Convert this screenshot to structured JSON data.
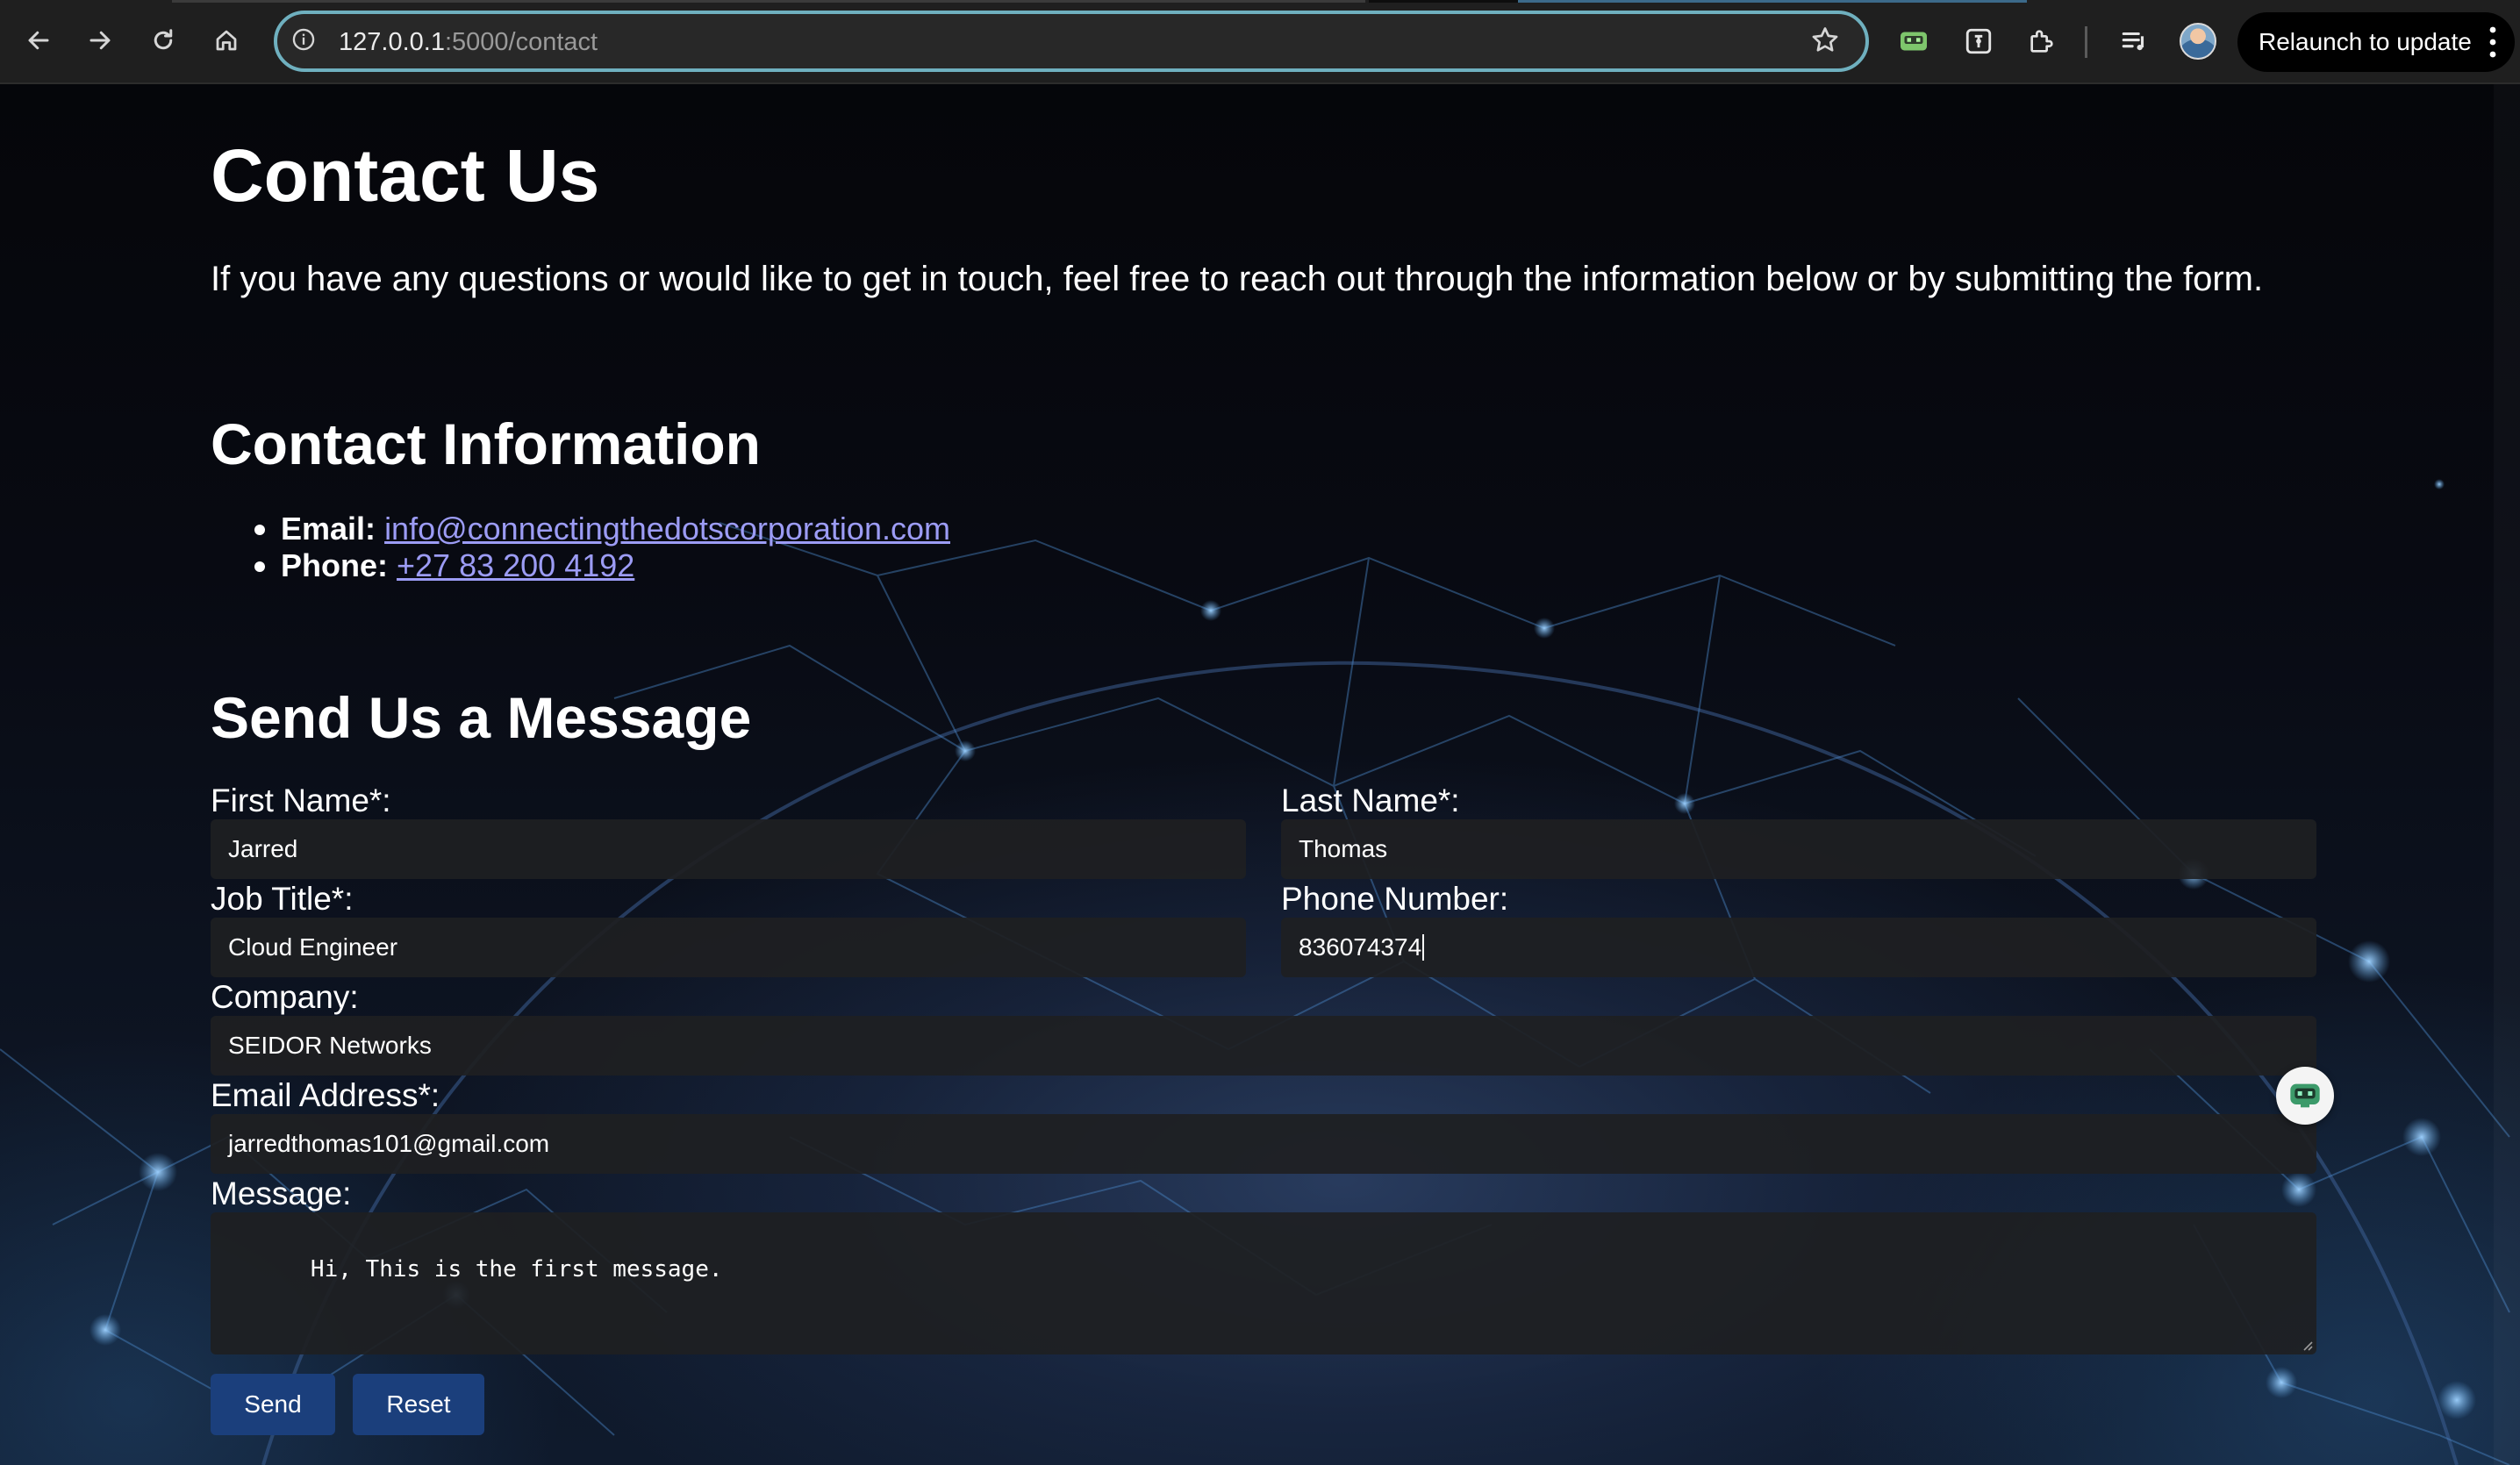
{
  "browser": {
    "url_host": "127.0.0.1",
    "url_path": ":5000/contact",
    "relaunch_label": "Relaunch to update"
  },
  "page": {
    "title": "Contact Us",
    "intro": "If you have any questions or would like to get in touch, feel free to reach out through the information below or by submitting the form.",
    "contact_info": {
      "heading": "Contact Information",
      "email_label": "Email:",
      "email_value": "info@connectingthedotscorporation.com",
      "phone_label": "Phone:",
      "phone_value": "+27 83 200 4192"
    },
    "form": {
      "heading": "Send Us a Message",
      "first_name": {
        "label": "First Name*:",
        "value": "Jarred"
      },
      "last_name": {
        "label": "Last Name*:",
        "value": "Thomas"
      },
      "job_title": {
        "label": "Job Title*:",
        "value": "Cloud Engineer"
      },
      "phone_number": {
        "label": "Phone Number:",
        "value": "836074374"
      },
      "company": {
        "label": "Company:",
        "value": "SEIDOR Networks"
      },
      "email": {
        "label": "Email Address*:",
        "value": "jarredthomas101@gmail.com"
      },
      "message": {
        "label": "Message:",
        "value": "Hi, This is the first message."
      },
      "send_label": "Send",
      "reset_label": "Reset"
    }
  },
  "icons": {
    "back": "arrow-left-icon",
    "forward": "arrow-right-icon",
    "reload": "reload-icon",
    "home": "home-icon",
    "site_info": "info-icon",
    "bookmark": "star-icon",
    "extensions": [
      "robot-extension-icon",
      "password-manager-icon",
      "puzzle-icon",
      "media-queue-icon"
    ],
    "menu": "kebab-menu-icon",
    "chat": "chatbot-icon"
  },
  "colors": {
    "link": "#9c9cf5",
    "button": "#1b3f7c",
    "omnibox_focus": "#6fb0bf",
    "field_bg": "#1e1f22"
  }
}
